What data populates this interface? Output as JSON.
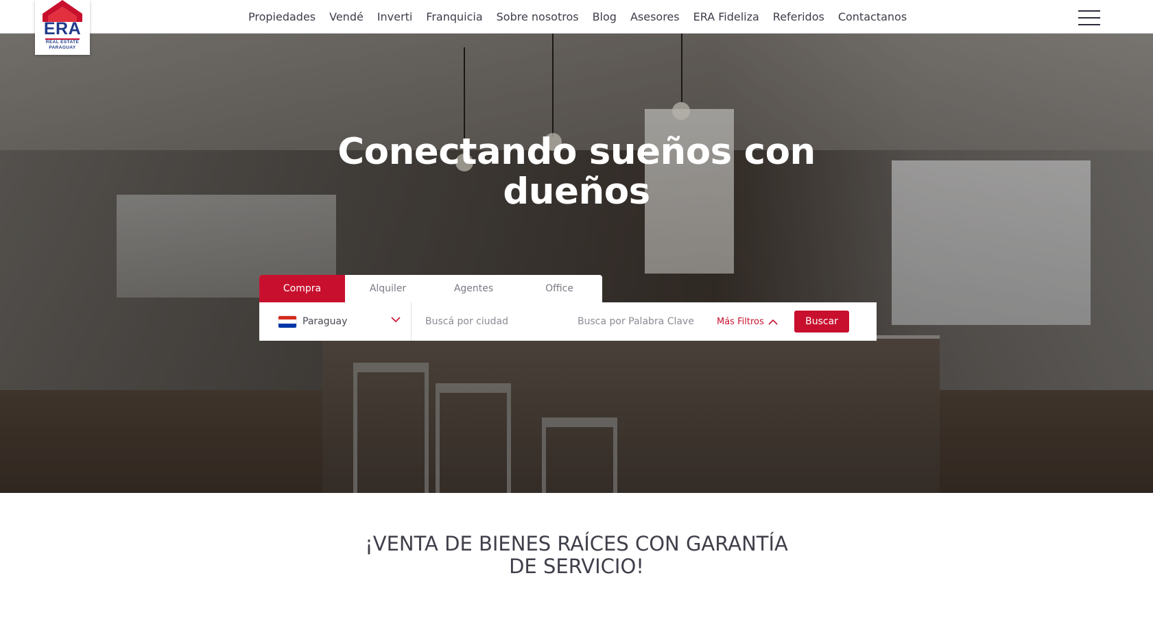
{
  "brand": {
    "logo_text": "ERA",
    "logo_subtext_1": "REAL ESTATE",
    "logo_subtext_2": "PARAGUAY",
    "primary_color": "#c8102e",
    "logo_blue": "#1f3a8a"
  },
  "nav": {
    "items": [
      {
        "label": "Propiedades"
      },
      {
        "label": "Vendé"
      },
      {
        "label": "Inverti"
      },
      {
        "label": "Franquicia"
      },
      {
        "label": "Sobre nosotros"
      },
      {
        "label": "Blog"
      },
      {
        "label": "Asesores"
      },
      {
        "label": "ERA Fideliza"
      },
      {
        "label": "Referidos"
      },
      {
        "label": "Contactanos"
      }
    ],
    "menu_icon": "hamburger-menu-icon"
  },
  "hero": {
    "title": "Conectando sueños con dueños"
  },
  "search": {
    "tabs": [
      {
        "label": "Compra",
        "active": true
      },
      {
        "label": "Alquiler",
        "active": false
      },
      {
        "label": "Agentes",
        "active": false
      },
      {
        "label": "Office",
        "active": false
      }
    ],
    "country": "Paraguay",
    "country_flag_icon": "paraguay-flag-icon",
    "city_placeholder": "Buscá por ciudad",
    "keyword_placeholder": "Busca por Palabra Clave",
    "more_filters_label": "Más Filtros",
    "search_button_label": "Buscar"
  },
  "tagline": {
    "text": "¡VENTA DE BIENES RAÍCES CON GARANTÍA DE SERVICIO!"
  }
}
